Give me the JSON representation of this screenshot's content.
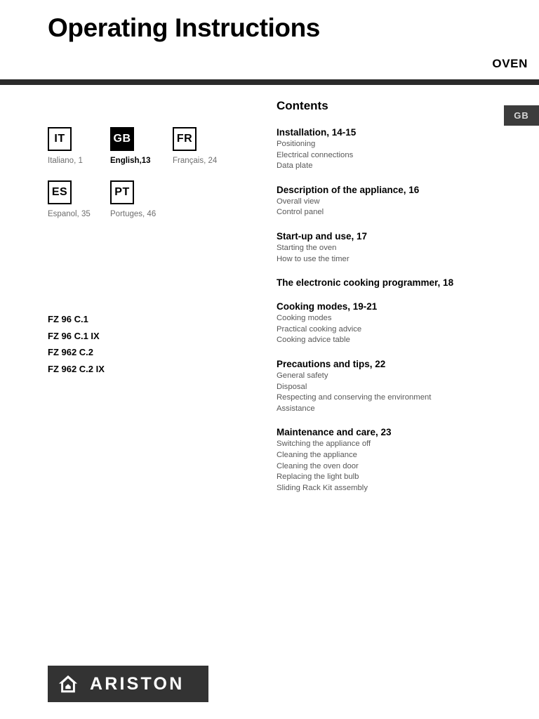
{
  "header": {
    "title": "Operating Instructions",
    "appliance": "OVEN",
    "edge_tab": "GB",
    "rule_color": "#2b2b2b"
  },
  "languages": [
    {
      "code": "IT",
      "label": "Italiano, 1",
      "active": false
    },
    {
      "code": "GB",
      "label": "English,13",
      "active": true
    },
    {
      "code": "FR",
      "label": "Français, 24",
      "active": false
    },
    {
      "code": "ES",
      "label": "Espanol, 35",
      "active": false
    },
    {
      "code": "PT",
      "label": "Portuges, 46",
      "active": false
    }
  ],
  "models": [
    "FZ 96 C.1",
    "FZ 96 C.1 IX",
    "FZ 962 C.2",
    "FZ 962 C.2 IX"
  ],
  "contents": {
    "title": "Contents",
    "sections": [
      {
        "heading": "Installation, 14-15",
        "items": [
          "Positioning",
          "Electrical connections",
          "Data plate"
        ]
      },
      {
        "heading": "Description of the appliance, 16",
        "items": [
          "Overall view",
          "Control panel"
        ]
      },
      {
        "heading": "Start-up and use, 17",
        "items": [
          "Starting the oven",
          "How to use the timer"
        ]
      },
      {
        "heading": "The electronic cooking programmer, 18",
        "items": []
      },
      {
        "heading": "Cooking modes, 19-21",
        "items": [
          "Cooking modes",
          "Practical cooking advice",
          "Cooking advice table"
        ]
      },
      {
        "heading": "Precautions and tips, 22",
        "items": [
          "General safety",
          "Disposal",
          "Respecting and conserving the environment",
          "Assistance"
        ]
      },
      {
        "heading": "Maintenance and care, 23",
        "items": [
          "Switching the appliance off",
          "Cleaning the appliance",
          "Cleaning the oven door",
          "Replacing the light bulb",
          "Sliding Rack Kit assembly"
        ]
      }
    ]
  },
  "brand": {
    "name": "ARISTON",
    "mark": "house-icon",
    "background": "#333333",
    "text_color": "#ffffff"
  }
}
